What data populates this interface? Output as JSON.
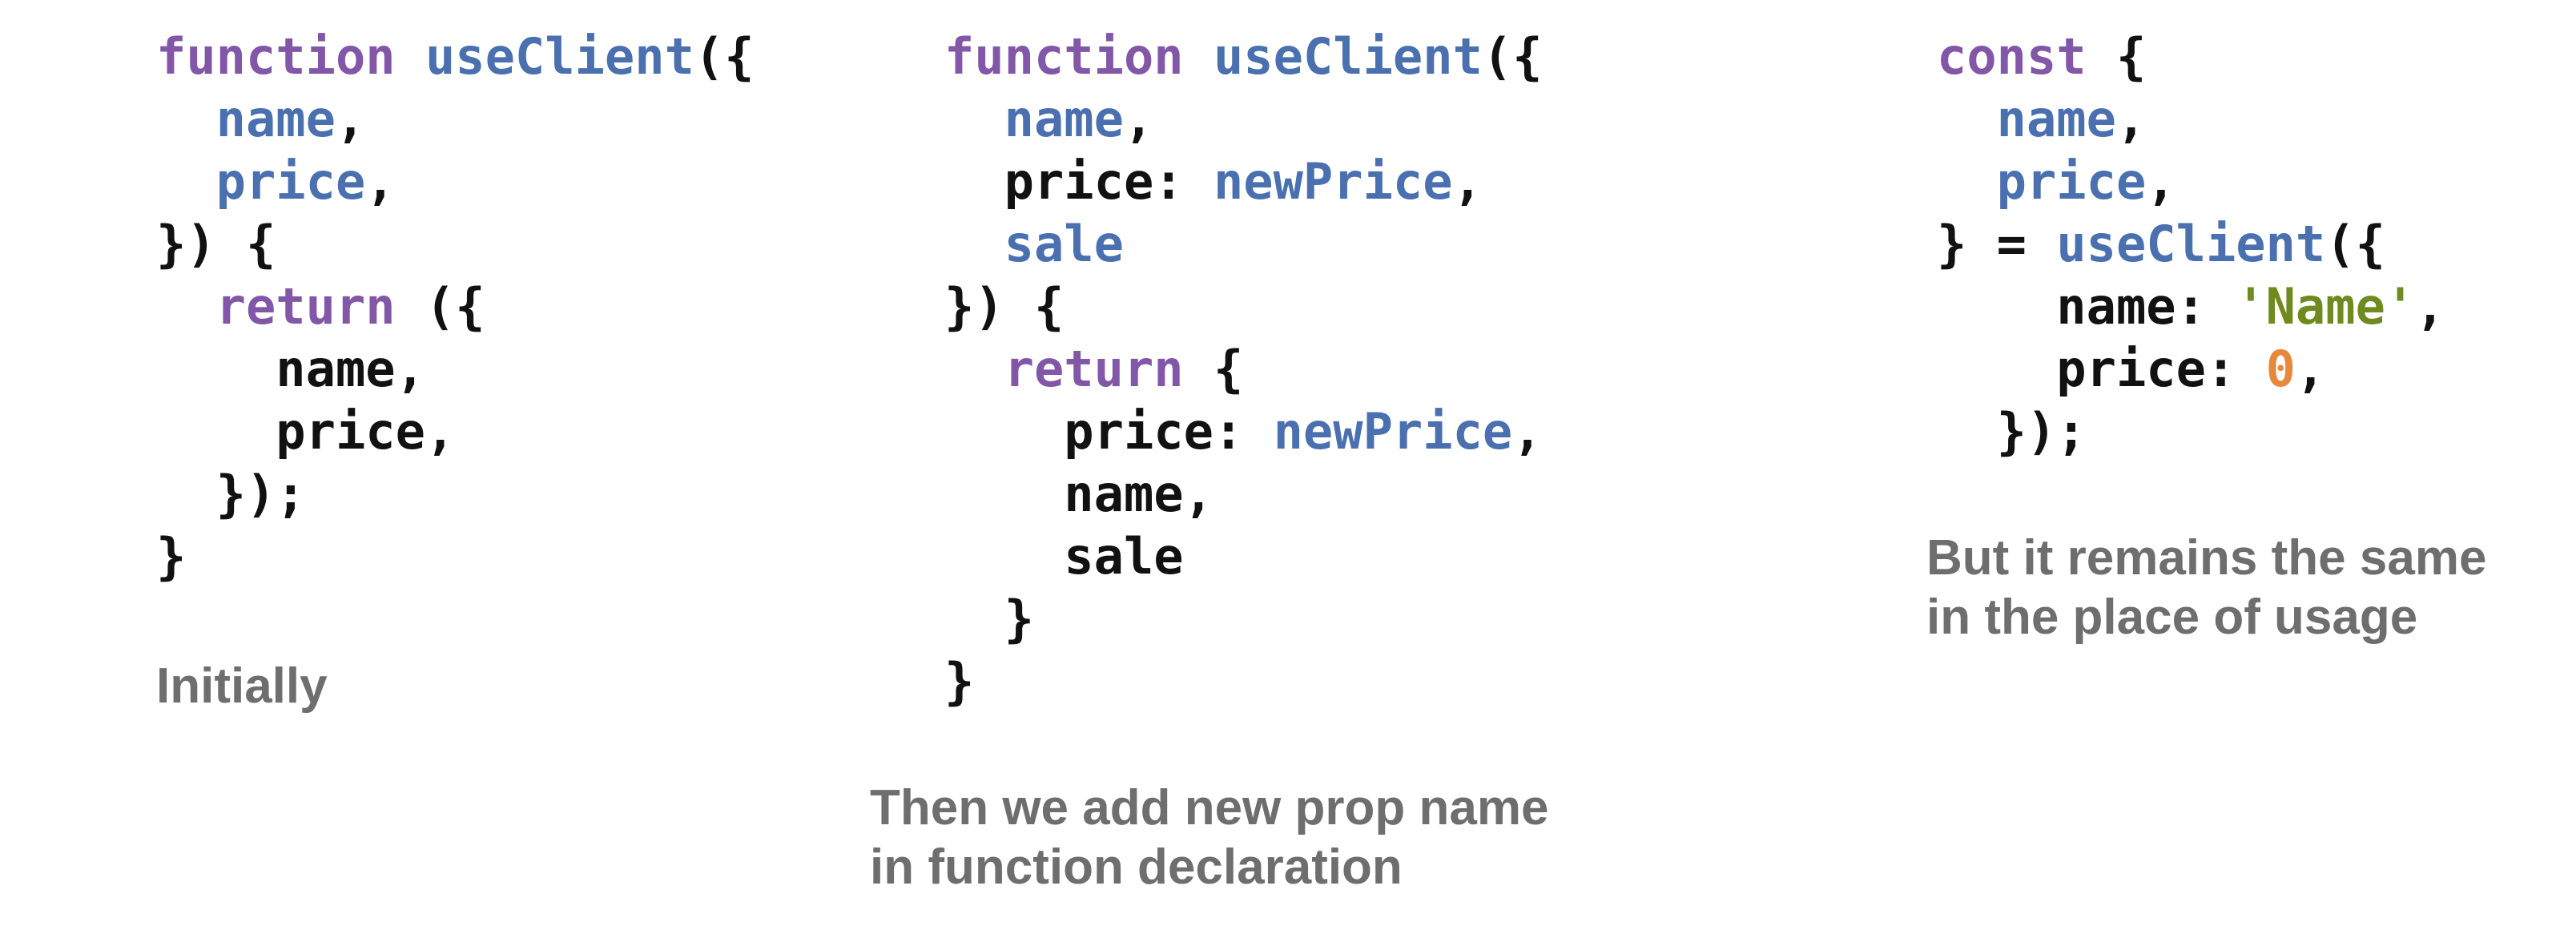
{
  "colors": {
    "keyword": "#8257a8",
    "identifier": "#4a70b0",
    "string": "#6f8a1e",
    "number": "#e8883a",
    "caption": "#6e6e6e"
  },
  "panels": [
    {
      "code": [
        [
          {
            "t": "function",
            "c": "kw"
          },
          {
            "t": " ",
            "c": "plain"
          },
          {
            "t": "useClient",
            "c": "fn"
          },
          {
            "t": "({",
            "c": "plain"
          }
        ],
        [
          {
            "t": "  ",
            "c": "plain"
          },
          {
            "t": "name",
            "c": "fn"
          },
          {
            "t": ",",
            "c": "plain"
          }
        ],
        [
          {
            "t": "  ",
            "c": "plain"
          },
          {
            "t": "price",
            "c": "fn"
          },
          {
            "t": ",",
            "c": "plain"
          }
        ],
        [
          {
            "t": "}) {",
            "c": "plain"
          }
        ],
        [
          {
            "t": "  ",
            "c": "plain"
          },
          {
            "t": "return",
            "c": "kw"
          },
          {
            "t": " ({",
            "c": "plain"
          }
        ],
        [
          {
            "t": "    name,",
            "c": "plain"
          }
        ],
        [
          {
            "t": "    price,",
            "c": "plain"
          }
        ],
        [
          {
            "t": "  });",
            "c": "plain"
          }
        ],
        [
          {
            "t": "}",
            "c": "plain"
          }
        ]
      ],
      "caption": [
        "Initially"
      ]
    },
    {
      "code": [
        [
          {
            "t": "function",
            "c": "kw"
          },
          {
            "t": " ",
            "c": "plain"
          },
          {
            "t": "useClient",
            "c": "fn"
          },
          {
            "t": "({",
            "c": "plain"
          }
        ],
        [
          {
            "t": "  ",
            "c": "plain"
          },
          {
            "t": "name",
            "c": "fn"
          },
          {
            "t": ",",
            "c": "plain"
          }
        ],
        [
          {
            "t": "  price: ",
            "c": "plain"
          },
          {
            "t": "newPrice",
            "c": "fn"
          },
          {
            "t": ",",
            "c": "plain"
          }
        ],
        [
          {
            "t": "  ",
            "c": "plain"
          },
          {
            "t": "sale",
            "c": "fn"
          }
        ],
        [
          {
            "t": "}) {",
            "c": "plain"
          }
        ],
        [
          {
            "t": "  ",
            "c": "plain"
          },
          {
            "t": "return",
            "c": "kw"
          },
          {
            "t": " {",
            "c": "plain"
          }
        ],
        [
          {
            "t": "    price: ",
            "c": "plain"
          },
          {
            "t": "newPrice",
            "c": "fn"
          },
          {
            "t": ",",
            "c": "plain"
          }
        ],
        [
          {
            "t": "    name,",
            "c": "plain"
          }
        ],
        [
          {
            "t": "    sale",
            "c": "plain"
          }
        ],
        [
          {
            "t": "  }",
            "c": "plain"
          }
        ],
        [
          {
            "t": "}",
            "c": "plain"
          }
        ]
      ],
      "caption": [
        "Then we add new prop name",
        "in function declaration"
      ]
    },
    {
      "code": [
        [
          {
            "t": "const",
            "c": "kw"
          },
          {
            "t": " {",
            "c": "plain"
          }
        ],
        [
          {
            "t": "  ",
            "c": "plain"
          },
          {
            "t": "name",
            "c": "fn"
          },
          {
            "t": ",",
            "c": "plain"
          }
        ],
        [
          {
            "t": "  ",
            "c": "plain"
          },
          {
            "t": "price",
            "c": "fn"
          },
          {
            "t": ",",
            "c": "plain"
          }
        ],
        [
          {
            "t": "} = ",
            "c": "plain"
          },
          {
            "t": "useClient",
            "c": "fn"
          },
          {
            "t": "({",
            "c": "plain"
          }
        ],
        [
          {
            "t": "    name: ",
            "c": "plain"
          },
          {
            "t": "'Name'",
            "c": "str"
          },
          {
            "t": ",",
            "c": "plain"
          }
        ],
        [
          {
            "t": "    price: ",
            "c": "plain"
          },
          {
            "t": "0",
            "c": "num"
          },
          {
            "t": ",",
            "c": "plain"
          }
        ],
        [
          {
            "t": "  });",
            "c": "plain"
          }
        ]
      ],
      "caption": [
        "But it remains the same",
        "in the place of usage"
      ]
    }
  ]
}
